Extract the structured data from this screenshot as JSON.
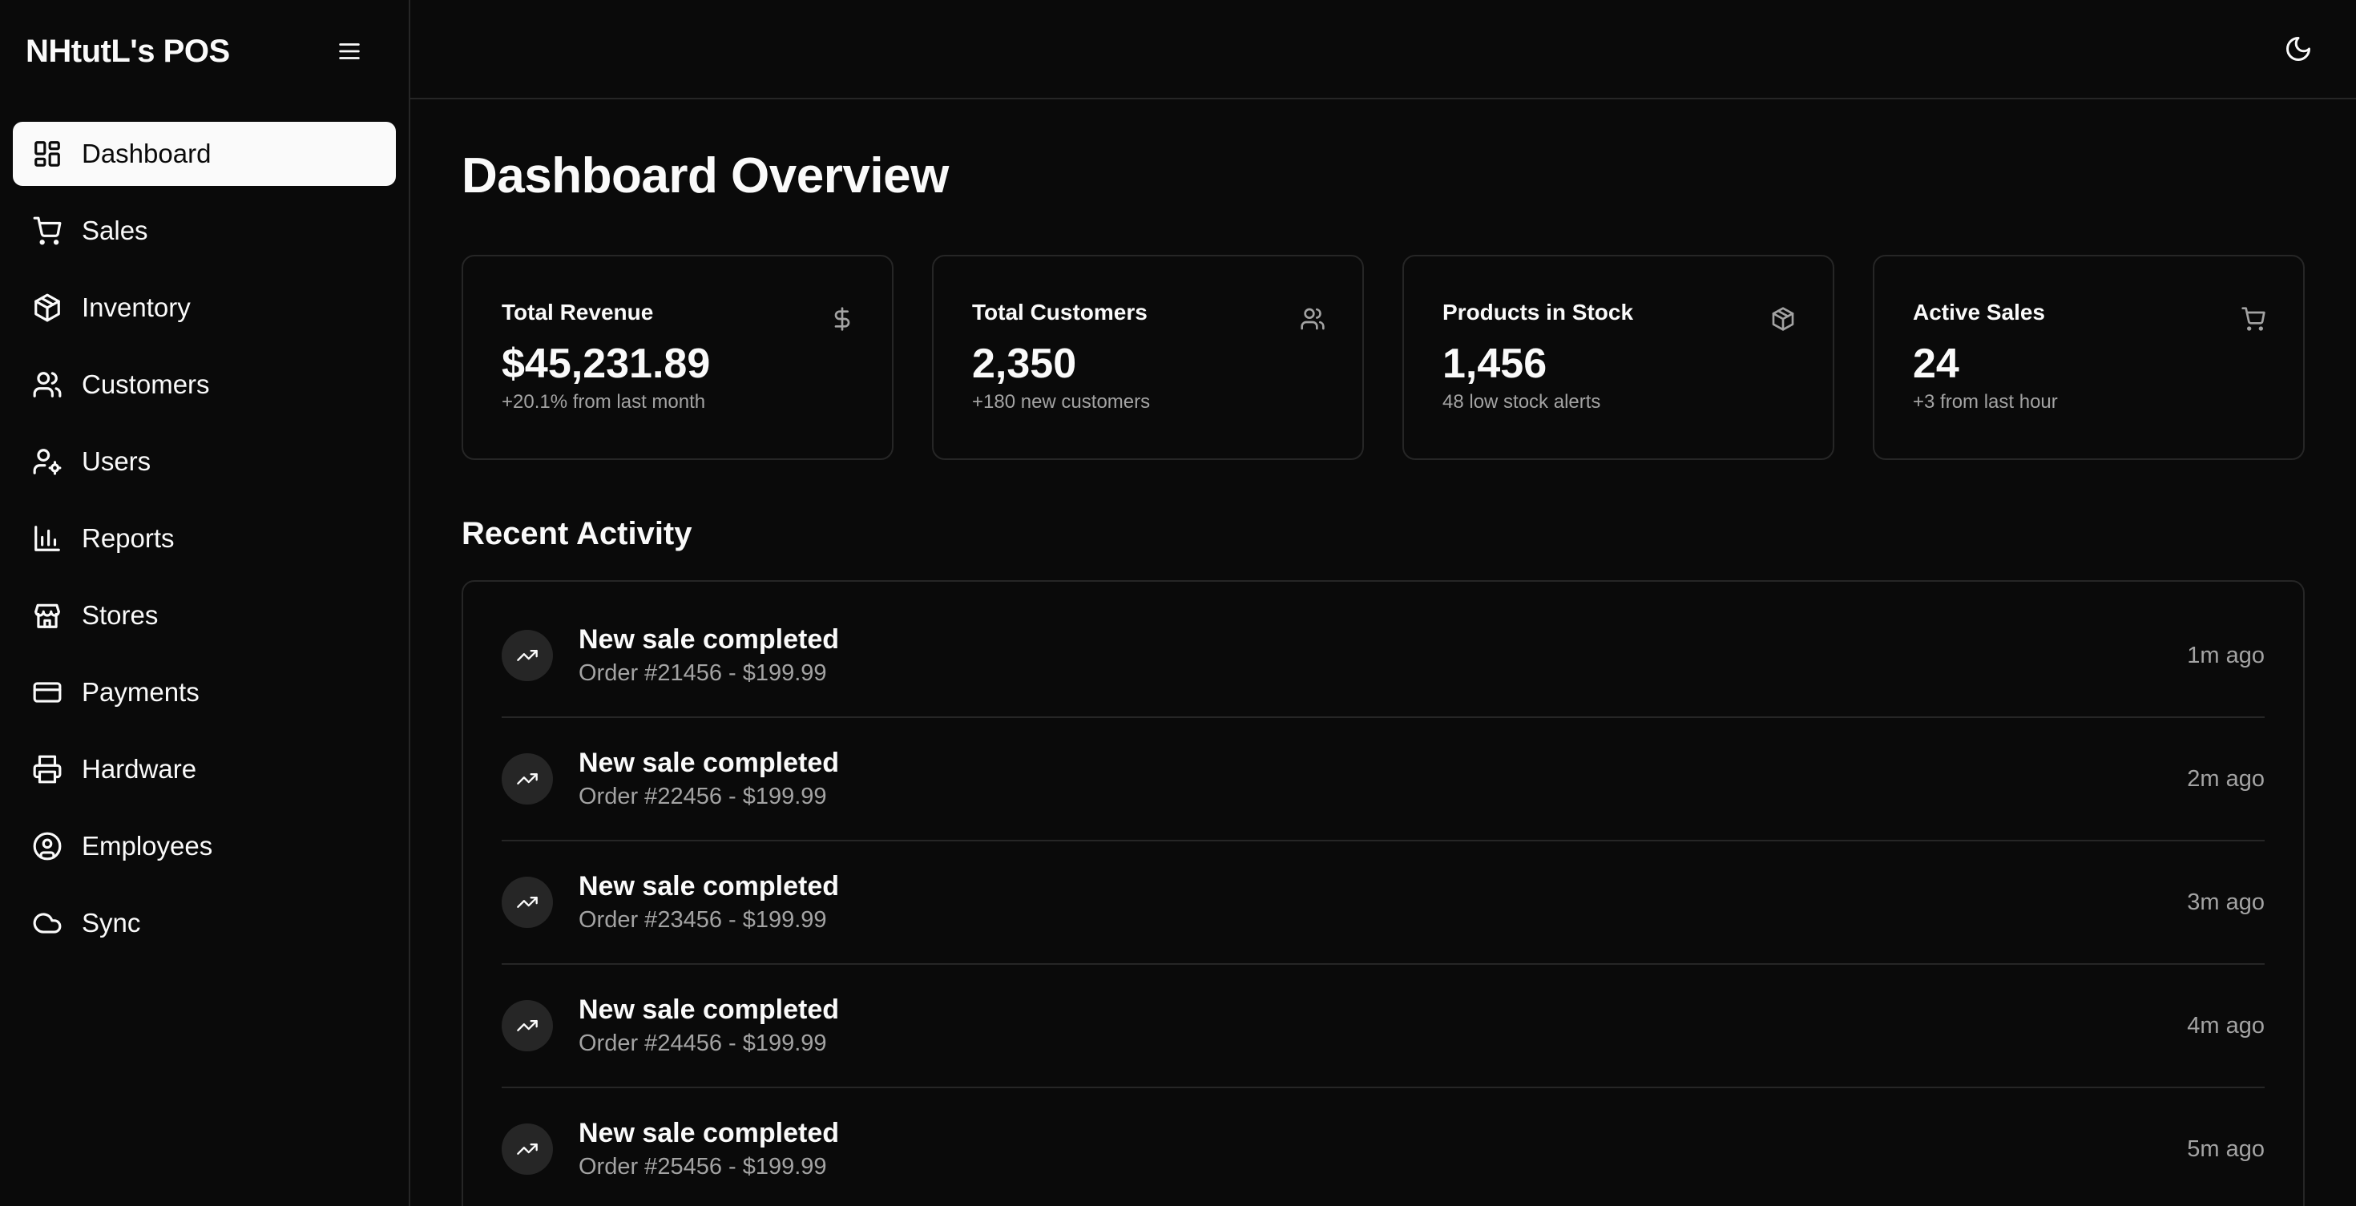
{
  "app": {
    "brand": "NHtutL's POS"
  },
  "sidebar": {
    "items": [
      {
        "label": "Dashboard",
        "icon": "dashboard-icon",
        "active": true
      },
      {
        "label": "Sales",
        "icon": "cart-icon"
      },
      {
        "label": "Inventory",
        "icon": "package-icon"
      },
      {
        "label": "Customers",
        "icon": "users-icon"
      },
      {
        "label": "Users",
        "icon": "user-cog-icon"
      },
      {
        "label": "Reports",
        "icon": "bar-chart-icon"
      },
      {
        "label": "Stores",
        "icon": "store-icon"
      },
      {
        "label": "Payments",
        "icon": "credit-card-icon"
      },
      {
        "label": "Hardware",
        "icon": "printer-icon"
      },
      {
        "label": "Employees",
        "icon": "user-circle-icon"
      },
      {
        "label": "Sync",
        "icon": "cloud-icon"
      }
    ]
  },
  "header": {
    "theme_icon": "moon-icon"
  },
  "main": {
    "title": "Dashboard Overview",
    "stats": [
      {
        "title": "Total Revenue",
        "value": "$45,231.89",
        "sub": "+20.1% from last month",
        "icon": "dollar-icon"
      },
      {
        "title": "Total Customers",
        "value": "2,350",
        "sub": "+180 new customers",
        "icon": "users-icon"
      },
      {
        "title": "Products in Stock",
        "value": "1,456",
        "sub": "48 low stock alerts",
        "icon": "package-icon"
      },
      {
        "title": "Active Sales",
        "value": "24",
        "sub": "+3 from last hour",
        "icon": "cart-icon"
      }
    ],
    "recent_title": "Recent Activity",
    "activity": [
      {
        "title": "New sale completed",
        "desc": "Order #21456 - $199.99",
        "time": "1m ago"
      },
      {
        "title": "New sale completed",
        "desc": "Order #22456 - $199.99",
        "time": "2m ago"
      },
      {
        "title": "New sale completed",
        "desc": "Order #23456 - $199.99",
        "time": "3m ago"
      },
      {
        "title": "New sale completed",
        "desc": "Order #24456 - $199.99",
        "time": "4m ago"
      },
      {
        "title": "New sale completed",
        "desc": "Order #25456 - $199.99",
        "time": "5m ago"
      }
    ]
  },
  "colors": {
    "background": "#0a0a0a",
    "foreground": "#fafafa",
    "muted": "#a3a3a3",
    "border": "#262626",
    "active_bg": "#fafafa"
  }
}
